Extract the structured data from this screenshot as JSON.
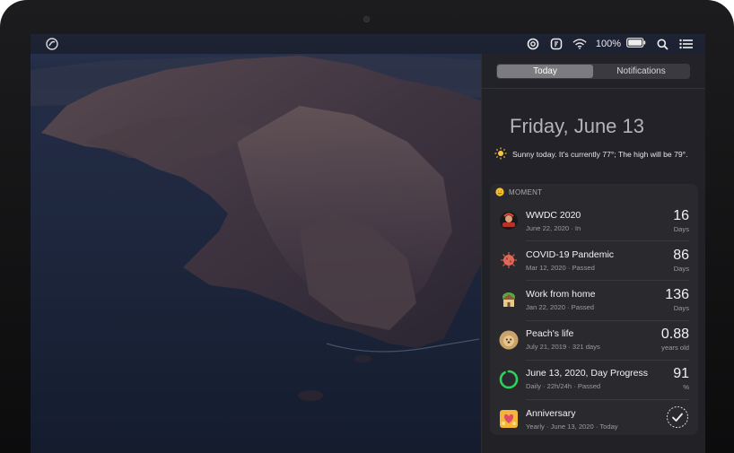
{
  "menubar": {
    "battery_percent": "100%"
  },
  "notification_center": {
    "tabs": [
      {
        "label": "Today",
        "active": true
      },
      {
        "label": "Notifications",
        "active": false
      }
    ],
    "date_heading": "Friday, June 13",
    "weather": {
      "icon": "sun-icon",
      "text": "Sunny today. It's currently 77°; The high will be 79°."
    }
  },
  "moment_widget": {
    "header": "MOMENT",
    "items": [
      {
        "icon": "wwdc-icon",
        "title": "WWDC 2020",
        "subtitle": "June 22, 2020 · In",
        "value": "16",
        "unit": "Days"
      },
      {
        "icon": "virus-icon",
        "title": "COVID-19 Pandemic",
        "subtitle": "Mar 12, 2020 · Passed",
        "value": "86",
        "unit": "Days"
      },
      {
        "icon": "house-icon",
        "title": "Work from home",
        "subtitle": "Jan 22, 2020 · Passed",
        "value": "136",
        "unit": "Days"
      },
      {
        "icon": "pet-avatar-icon",
        "title": "Peach's life",
        "subtitle": "July 21, 2019 · 321 days",
        "value": "0.88",
        "unit": "years old"
      },
      {
        "icon": "progress-ring-icon",
        "title": "June 13, 2020, Day Progress",
        "subtitle": "Daily · 22h/24h · Passed",
        "value": "91",
        "unit": "%",
        "progress": 0.91
      },
      {
        "icon": "anniversary-icon",
        "title": "Anniversary",
        "subtitle": "Yearly · June 13, 2020 · Today",
        "value": "",
        "unit": "",
        "status_icon": "checkmark-circle-icon"
      }
    ]
  },
  "colors": {
    "panel_bg": "#222226",
    "widget_bg": "#2a2a2e",
    "progress_green": "#2fd05c",
    "segment_active": "#7b7b80"
  }
}
